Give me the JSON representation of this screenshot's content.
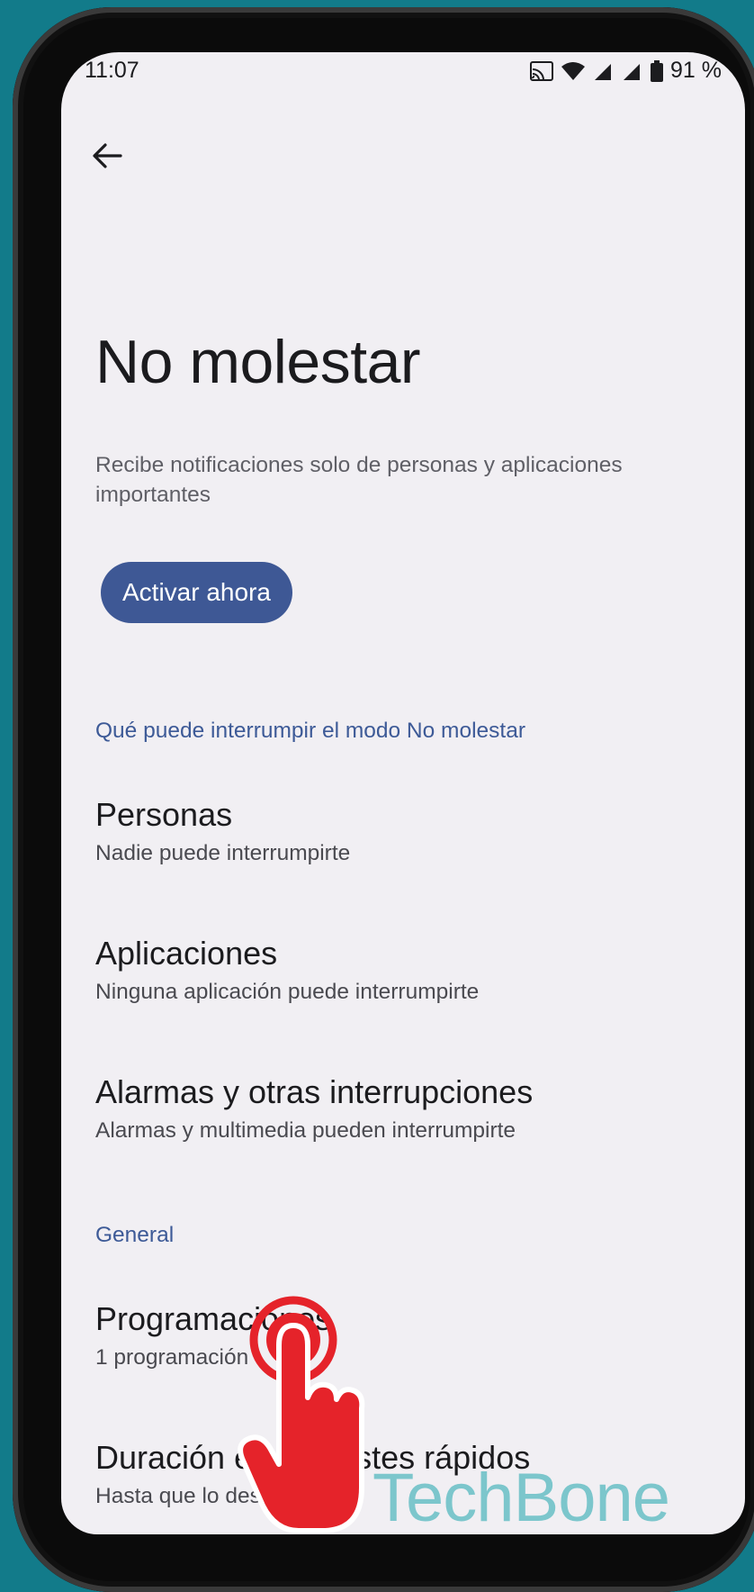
{
  "status_bar": {
    "time": "11:07",
    "battery": "91 %"
  },
  "page": {
    "title": "No molestar",
    "description": "Recibe notificaciones solo de personas y aplicaciones importantes",
    "activate_button": "Activar ahora"
  },
  "sections": {
    "interrupt_header": "Qué puede interrumpir el modo No molestar",
    "general_header": "General"
  },
  "items": [
    {
      "title": "Personas",
      "subtitle": "Nadie puede interrumpirte"
    },
    {
      "title": "Aplicaciones",
      "subtitle": "Ninguna aplicación puede interrumpirte"
    },
    {
      "title": "Alarmas y otras interrupciones",
      "subtitle": "Alarmas y multimedia pueden interrumpirte"
    },
    {
      "title": "Programaciones",
      "subtitle": "1 programación"
    },
    {
      "title": "Duración e",
      "title_end": "ustes rápidos",
      "subtitle": "Hasta que lo desa"
    }
  ],
  "watermark": "TechBone",
  "colors": {
    "accent": "#3e5895",
    "background": "#f1eff3",
    "frame_bg": "#127b8a",
    "tap_indicator": "#e5232a"
  }
}
